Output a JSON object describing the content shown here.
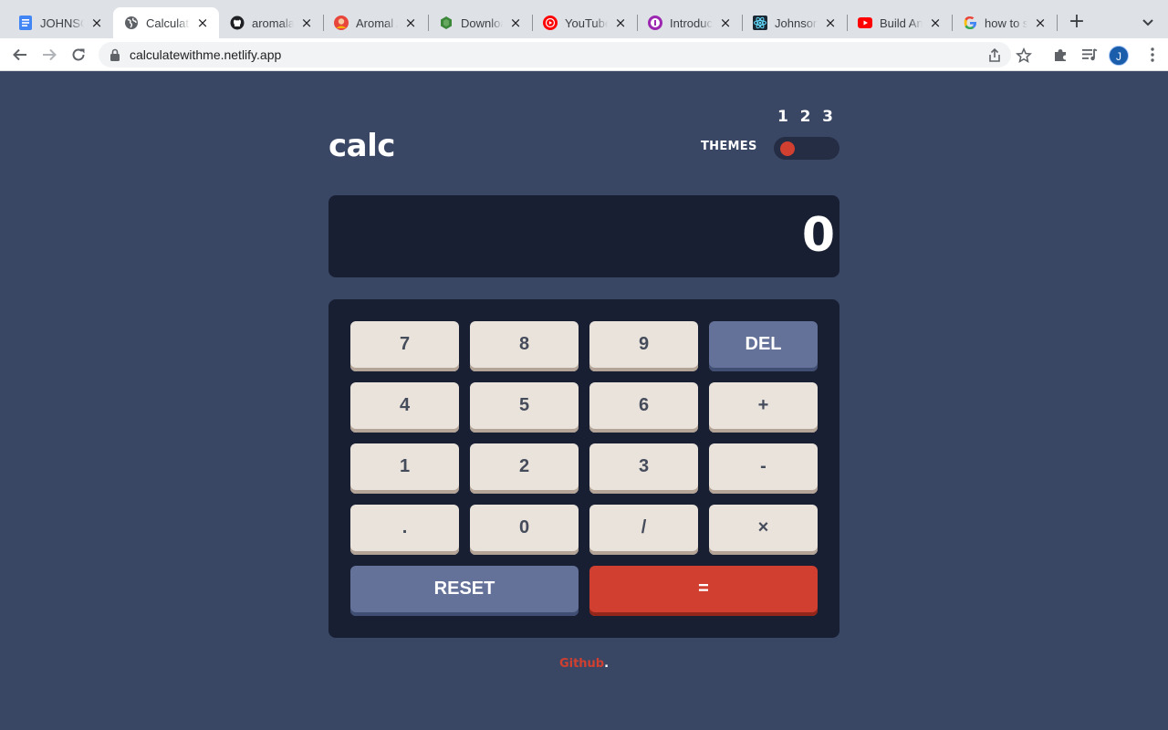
{
  "browser": {
    "tabs": [
      {
        "title": "JOHNSON",
        "favicon": "docs-icon",
        "color": "#4285f4"
      },
      {
        "title": "Calculator",
        "favicon": "globe-icon",
        "color": "#5f6368",
        "active": true
      },
      {
        "title": "aromalan",
        "favicon": "github-icon",
        "color": "#202124"
      },
      {
        "title": "Aromal A",
        "favicon": "avatar-icon",
        "color": "#f4b400"
      },
      {
        "title": "Download",
        "favicon": "nodejs-icon",
        "color": "#3c873a"
      },
      {
        "title": "YouTube",
        "favicon": "youtube-music-icon",
        "color": "#ff0000"
      },
      {
        "title": "Introduct",
        "favicon": "purple-circle-icon",
        "color": "#9c27b0"
      },
      {
        "title": "Johnson",
        "favicon": "react-icon",
        "color": "#1b2733"
      },
      {
        "title": "Build And",
        "favicon": "youtube-icon",
        "color": "#ff0000"
      },
      {
        "title": "how to s",
        "favicon": "google-icon",
        "color": "#4285f4"
      }
    ],
    "url": "calculatewithme.netlify.app",
    "profile_initial": "J"
  },
  "app": {
    "title": "calc",
    "theme_label": "THEMES",
    "theme_numbers": [
      "1",
      "2",
      "3"
    ],
    "active_theme": 1,
    "display_value": "0",
    "keys": [
      {
        "label": "7",
        "style": "std"
      },
      {
        "label": "8",
        "style": "std"
      },
      {
        "label": "9",
        "style": "std"
      },
      {
        "label": "DEL",
        "style": "blue"
      },
      {
        "label": "4",
        "style": "std"
      },
      {
        "label": "5",
        "style": "std"
      },
      {
        "label": "6",
        "style": "std"
      },
      {
        "label": "+",
        "style": "std"
      },
      {
        "label": "1",
        "style": "std"
      },
      {
        "label": "2",
        "style": "std"
      },
      {
        "label": "3",
        "style": "std"
      },
      {
        "label": "-",
        "style": "std"
      },
      {
        "label": ".",
        "style": "std"
      },
      {
        "label": "0",
        "style": "std"
      },
      {
        "label": "/",
        "style": "std"
      },
      {
        "label": "×",
        "style": "std"
      },
      {
        "label": "RESET",
        "style": "blue"
      },
      {
        "label": "=",
        "style": "red"
      }
    ],
    "colors": {
      "background": "#3a4764",
      "panel": "#181f33",
      "accent": "#d03f2f",
      "key": "#eae3dc",
      "key_blue": "#647198"
    }
  },
  "footer": {
    "link_text": "Github",
    "suffix": "."
  }
}
